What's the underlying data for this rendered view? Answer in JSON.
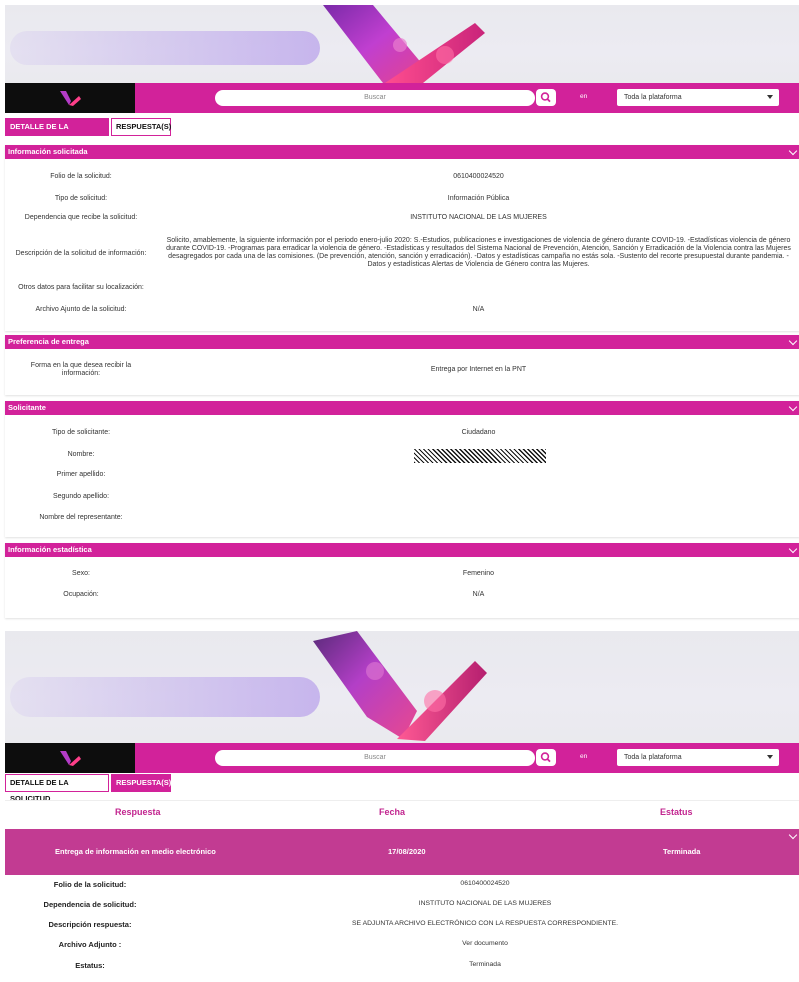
{
  "header": {
    "search_placeholder": "Buscar",
    "scope_connector": "en",
    "scope_selected": "Toda la plataforma"
  },
  "tabs": {
    "detalle": "DETALLE DE LA SOLICITUD",
    "respuestas": "RESPUESTA(S)"
  },
  "info_solicitada": {
    "title": "Información solicitada",
    "fields": [
      {
        "label": "Folio de la solicitud:",
        "value": "0610400024520"
      },
      {
        "label": "Tipo de solicitud:",
        "value": "Información Pública"
      },
      {
        "label": "Dependencia que recibe la solicitud:",
        "value": "INSTITUTO NACIONAL DE LAS MUJERES"
      },
      {
        "label": "Descripción de la solicitud de información:",
        "value": "Solicito, amablemente, la siguiente información por el periodo enero-julio 2020: S.-Estudios, publicaciones e investigaciones de violencia de género durante COVID-19. -Estadísticas violencia de género durante COVID-19. -Programas para erradicar la violencia de género. -Estadísticas y resultados del Sistema Nacional de Prevención, Atención, Sanción y Erradicación de la Violencia contra las Mujeres desagregados por cada una de las comisiones. (De prevención, atención, sanción y erradicación). -Datos y estadísticas campaña no estás sola. -Sustento del recorte presupuestal durante pandemia. -Datos y estadísticas Alertas de Violencia de Género contra las Mujeres."
      },
      {
        "label": "Otros datos para facilitar su localización:",
        "value": ""
      },
      {
        "label": "Archivo Ajunto de la solicitud:",
        "value": "N/A"
      }
    ]
  },
  "preferencia": {
    "title": "Preferencia de entrega",
    "label": "Forma en la que desea recibir la información:",
    "value": "Entrega por Internet en la PNT"
  },
  "solicitante": {
    "title": "Solicitante",
    "fields": [
      {
        "label": "Tipo de solicitante:",
        "value": "Ciudadano"
      },
      {
        "label": "Nombre:",
        "value": ""
      },
      {
        "label": "Primer apellido:",
        "value": ""
      },
      {
        "label": "Segundo apellido:",
        "value": ""
      },
      {
        "label": "Nombre del representante:",
        "value": ""
      }
    ]
  },
  "estadistica": {
    "title": "Información estadística",
    "fields": [
      {
        "label": "Sexo:",
        "value": "Femenino"
      },
      {
        "label": "Ocupación:",
        "value": "N/A"
      }
    ]
  },
  "respuestas": {
    "columns": [
      "Respuesta",
      "Fecha",
      "Estatus"
    ],
    "row": {
      "respuesta": "Entrega de información en medio electrónico",
      "fecha": "17/08/2020",
      "estatus": "Terminada"
    },
    "details": [
      {
        "label": "Folio de la solicitud:",
        "value": "0610400024520"
      },
      {
        "label": "Dependencia de solicitud:",
        "value": "INSTITUTO NACIONAL DE LAS MUJERES"
      },
      {
        "label": "Descripción respuesta:",
        "value": "SE ADJUNTA ARCHIVO ELECTRÓNICO CON LA RESPUESTA CORRESPONDIENTE."
      },
      {
        "label": "Archivo Adjunto :",
        "value": "Ver documento"
      },
      {
        "label": "Estatus:",
        "value": "Terminada"
      }
    ]
  },
  "colors": {
    "brand_magenta": "#d2229a",
    "row_magenta": "#c23b92",
    "nav_black": "#0d0d0d"
  },
  "icons": [
    "logo-ribbon-icon",
    "search-icon",
    "caret-down-icon",
    "chevron-down-icon"
  ]
}
